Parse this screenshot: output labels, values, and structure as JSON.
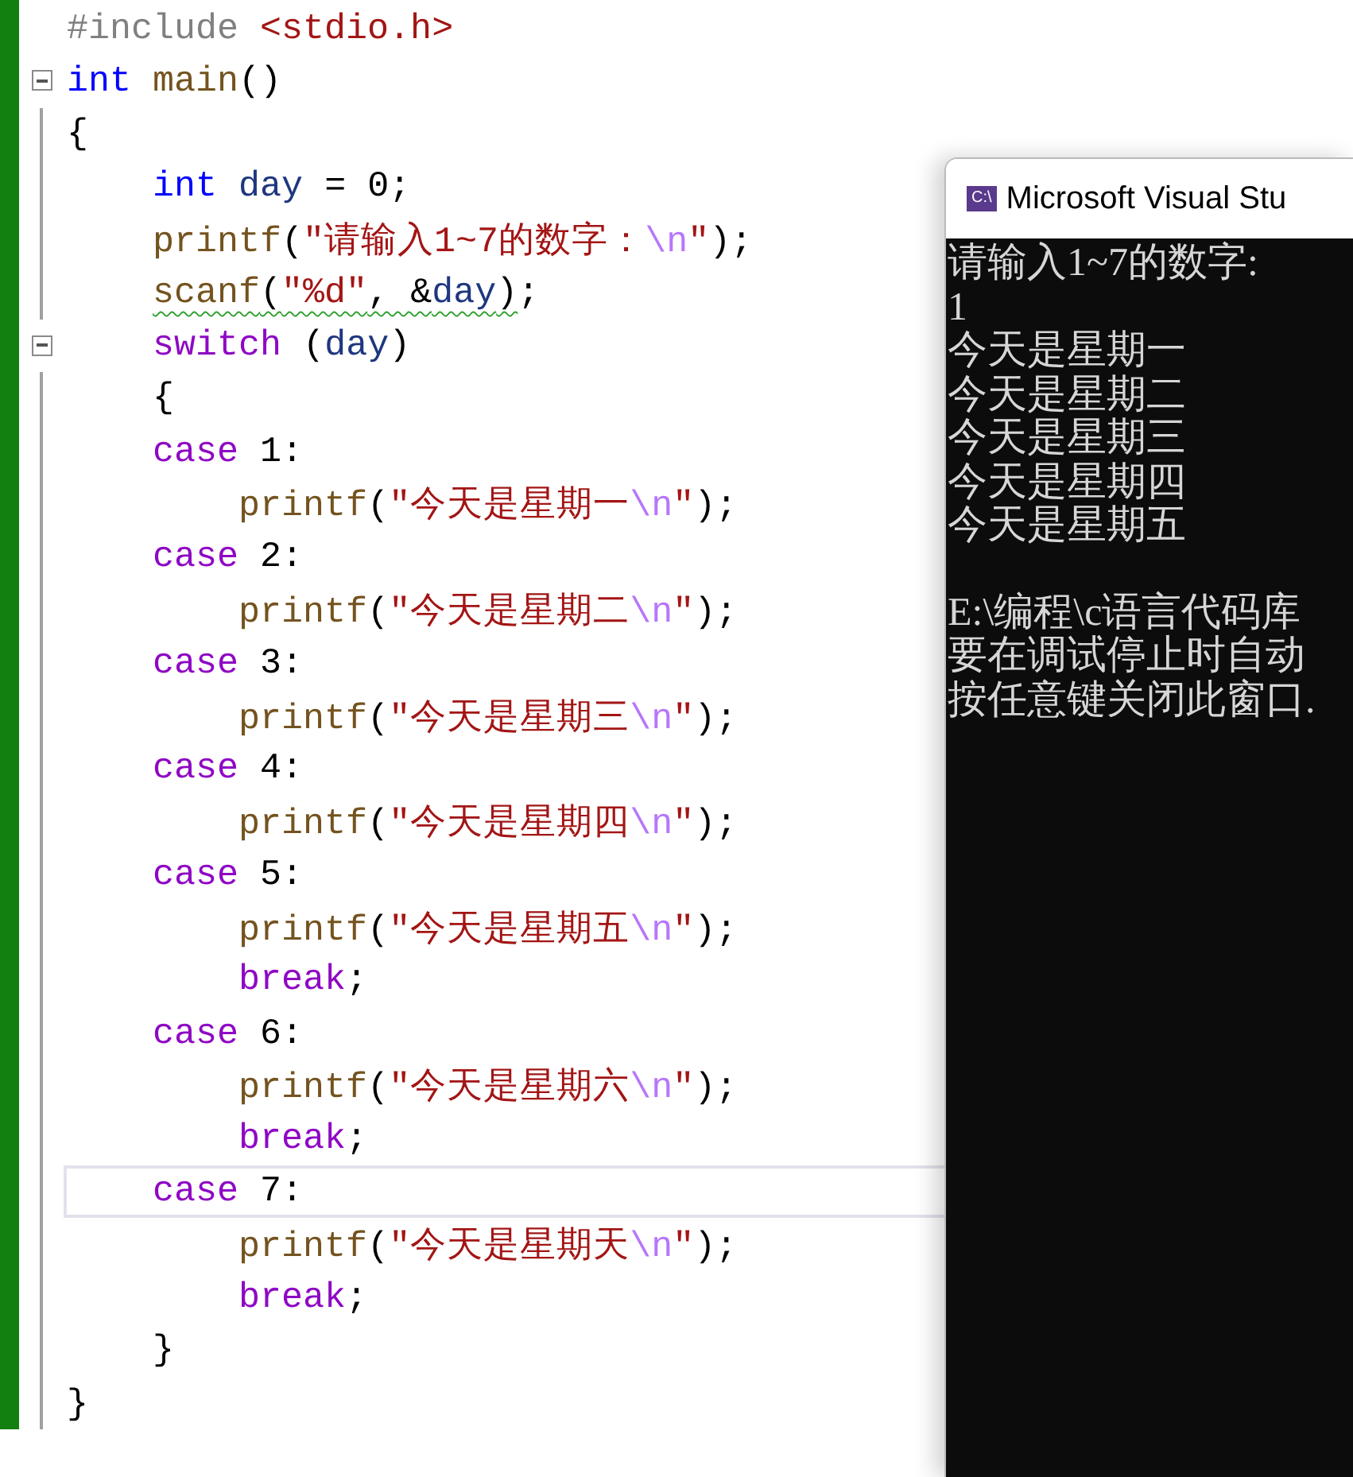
{
  "editor": {
    "lines": [
      {
        "fold": false,
        "current": false,
        "tokens": [
          {
            "text": "#include",
            "kind": "preproc"
          },
          {
            "text": " <stdio.h>",
            "kind": "string"
          }
        ]
      },
      {
        "fold": true,
        "current": false,
        "tokens": [
          {
            "text": "int",
            "kind": "keyword"
          },
          {
            "text": " main",
            "kind": "func"
          },
          {
            "text": "()",
            "kind": "plain"
          }
        ]
      },
      {
        "fold": false,
        "current": false,
        "tokens": [
          {
            "text": "{",
            "kind": "plain"
          }
        ]
      },
      {
        "fold": false,
        "current": false,
        "tokens": [
          {
            "text": "    int",
            "kind": "keyword"
          },
          {
            "text": " day",
            "kind": "var"
          },
          {
            "text": " = 0;",
            "kind": "plain"
          }
        ]
      },
      {
        "fold": false,
        "current": false,
        "tokens": [
          {
            "text": "    printf",
            "kind": "func"
          },
          {
            "text": "(",
            "kind": "plain"
          },
          {
            "text": "\"请输入1~7的数字：",
            "kind": "string"
          },
          {
            "text": "\\n",
            "kind": "escape"
          },
          {
            "text": "\"",
            "kind": "string"
          },
          {
            "text": ");",
            "kind": "plain"
          }
        ]
      },
      {
        "fold": false,
        "current": false,
        "tokens": [
          {
            "text": "    scanf",
            "kind": "func",
            "squiggle": true
          },
          {
            "text": "(",
            "kind": "plain",
            "squiggle": true
          },
          {
            "text": "\"%d\"",
            "kind": "string",
            "squiggle": true
          },
          {
            "text": ", &",
            "kind": "plain",
            "squiggle": true
          },
          {
            "text": "day",
            "kind": "var",
            "squiggle": true
          },
          {
            "text": ")",
            "kind": "plain",
            "squiggle": true
          },
          {
            "text": ";",
            "kind": "plain",
            "squiggle": false
          }
        ]
      },
      {
        "fold": true,
        "current": false,
        "tokens": [
          {
            "text": "    switch",
            "kind": "control"
          },
          {
            "text": " (",
            "kind": "plain"
          },
          {
            "text": "day",
            "kind": "var"
          },
          {
            "text": ")",
            "kind": "plain"
          }
        ]
      },
      {
        "fold": false,
        "current": false,
        "tokens": [
          {
            "text": "    {",
            "kind": "plain"
          }
        ]
      },
      {
        "fold": false,
        "current": false,
        "tokens": [
          {
            "text": "    case",
            "kind": "control"
          },
          {
            "text": " 1:",
            "kind": "plain"
          }
        ]
      },
      {
        "fold": false,
        "current": false,
        "tokens": [
          {
            "text": "        printf",
            "kind": "func"
          },
          {
            "text": "(",
            "kind": "plain"
          },
          {
            "text": "\"今天是星期一",
            "kind": "string"
          },
          {
            "text": "\\n",
            "kind": "escape"
          },
          {
            "text": "\"",
            "kind": "string"
          },
          {
            "text": ");",
            "kind": "plain"
          }
        ]
      },
      {
        "fold": false,
        "current": false,
        "tokens": [
          {
            "text": "    case",
            "kind": "control"
          },
          {
            "text": " 2:",
            "kind": "plain"
          }
        ]
      },
      {
        "fold": false,
        "current": false,
        "tokens": [
          {
            "text": "        printf",
            "kind": "func"
          },
          {
            "text": "(",
            "kind": "plain"
          },
          {
            "text": "\"今天是星期二",
            "kind": "string"
          },
          {
            "text": "\\n",
            "kind": "escape"
          },
          {
            "text": "\"",
            "kind": "string"
          },
          {
            "text": ");",
            "kind": "plain"
          }
        ]
      },
      {
        "fold": false,
        "current": false,
        "tokens": [
          {
            "text": "    case",
            "kind": "control"
          },
          {
            "text": " 3:",
            "kind": "plain"
          }
        ]
      },
      {
        "fold": false,
        "current": false,
        "tokens": [
          {
            "text": "        printf",
            "kind": "func"
          },
          {
            "text": "(",
            "kind": "plain"
          },
          {
            "text": "\"今天是星期三",
            "kind": "string"
          },
          {
            "text": "\\n",
            "kind": "escape"
          },
          {
            "text": "\"",
            "kind": "string"
          },
          {
            "text": ");",
            "kind": "plain"
          }
        ]
      },
      {
        "fold": false,
        "current": false,
        "tokens": [
          {
            "text": "    case",
            "kind": "control"
          },
          {
            "text": " 4:",
            "kind": "plain"
          }
        ]
      },
      {
        "fold": false,
        "current": false,
        "tokens": [
          {
            "text": "        printf",
            "kind": "func"
          },
          {
            "text": "(",
            "kind": "plain"
          },
          {
            "text": "\"今天是星期四",
            "kind": "string"
          },
          {
            "text": "\\n",
            "kind": "escape"
          },
          {
            "text": "\"",
            "kind": "string"
          },
          {
            "text": ");",
            "kind": "plain"
          }
        ]
      },
      {
        "fold": false,
        "current": false,
        "tokens": [
          {
            "text": "    case",
            "kind": "control"
          },
          {
            "text": " 5:",
            "kind": "plain"
          }
        ]
      },
      {
        "fold": false,
        "current": false,
        "tokens": [
          {
            "text": "        printf",
            "kind": "func"
          },
          {
            "text": "(",
            "kind": "plain"
          },
          {
            "text": "\"今天是星期五",
            "kind": "string"
          },
          {
            "text": "\\n",
            "kind": "escape"
          },
          {
            "text": "\"",
            "kind": "string"
          },
          {
            "text": ");",
            "kind": "plain"
          }
        ]
      },
      {
        "fold": false,
        "current": false,
        "tokens": [
          {
            "text": "        break",
            "kind": "control"
          },
          {
            "text": ";",
            "kind": "plain"
          }
        ]
      },
      {
        "fold": false,
        "current": false,
        "tokens": [
          {
            "text": "    case",
            "kind": "control"
          },
          {
            "text": " 6:",
            "kind": "plain"
          }
        ]
      },
      {
        "fold": false,
        "current": false,
        "tokens": [
          {
            "text": "        printf",
            "kind": "func"
          },
          {
            "text": "(",
            "kind": "plain"
          },
          {
            "text": "\"今天是星期六",
            "kind": "string"
          },
          {
            "text": "\\n",
            "kind": "escape"
          },
          {
            "text": "\"",
            "kind": "string"
          },
          {
            "text": ");",
            "kind": "plain"
          }
        ]
      },
      {
        "fold": false,
        "current": false,
        "tokens": [
          {
            "text": "        break",
            "kind": "control"
          },
          {
            "text": ";",
            "kind": "plain"
          }
        ]
      },
      {
        "fold": false,
        "current": true,
        "tokens": [
          {
            "text": "    case",
            "kind": "control"
          },
          {
            "text": " 7:",
            "kind": "plain"
          }
        ]
      },
      {
        "fold": false,
        "current": false,
        "tokens": [
          {
            "text": "        printf",
            "kind": "func"
          },
          {
            "text": "(",
            "kind": "plain"
          },
          {
            "text": "\"今天是星期天",
            "kind": "string"
          },
          {
            "text": "\\n",
            "kind": "escape"
          },
          {
            "text": "\"",
            "kind": "string"
          },
          {
            "text": ");",
            "kind": "plain"
          }
        ]
      },
      {
        "fold": false,
        "current": false,
        "tokens": [
          {
            "text": "        break",
            "kind": "control"
          },
          {
            "text": ";",
            "kind": "plain"
          }
        ]
      },
      {
        "fold": false,
        "current": false,
        "tokens": [
          {
            "text": "    }",
            "kind": "plain"
          }
        ]
      },
      {
        "fold": false,
        "current": false,
        "tokens": [
          {
            "text": "}",
            "kind": "plain"
          }
        ]
      }
    ]
  },
  "console": {
    "icon_text": "C:\\",
    "title": "Microsoft Visual Stu",
    "output_lines": [
      "请输入1~7的数字:",
      "1",
      "今天是星期一",
      "今天是星期二",
      "今天是星期三",
      "今天是星期四",
      "今天是星期五"
    ],
    "footer_lines": [
      "E:\\编程\\c语言代码库",
      "要在调试停止时自动",
      "按任意键关闭此窗口."
    ]
  }
}
